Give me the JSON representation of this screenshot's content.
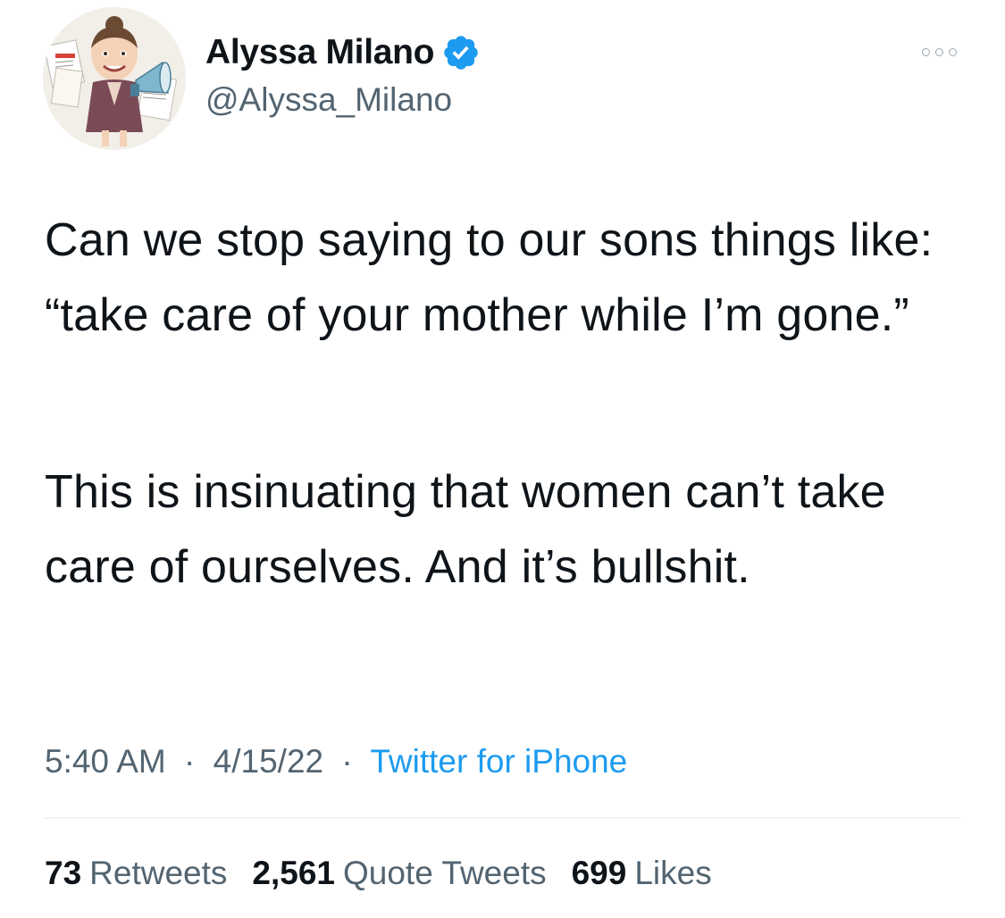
{
  "author": {
    "display_name": "Alyssa Milano",
    "handle": "@Alyssa_Milano",
    "verified_icon": "verified-badge-icon",
    "verified_color": "#1d9bf0"
  },
  "tweet": {
    "paragraph_1": "Can we stop saying to our sons things like: “take care of your mother while I’m gone.”",
    "paragraph_2": "This is insinuating that women can’t take care of ourselves. And it’s bullshit."
  },
  "meta": {
    "time": "5:40 AM",
    "separator": "·",
    "date": "4/15/22",
    "source": "Twitter for iPhone"
  },
  "stats": {
    "retweets_count": "73",
    "retweets_label": "Retweets",
    "quotes_count": "2,561",
    "quotes_label": "Quote Tweets",
    "likes_count": "699",
    "likes_label": "Likes"
  },
  "colors": {
    "text": "#0f1419",
    "secondary": "#536471",
    "link": "#1d9bf0",
    "divider": "#eff3f4"
  }
}
